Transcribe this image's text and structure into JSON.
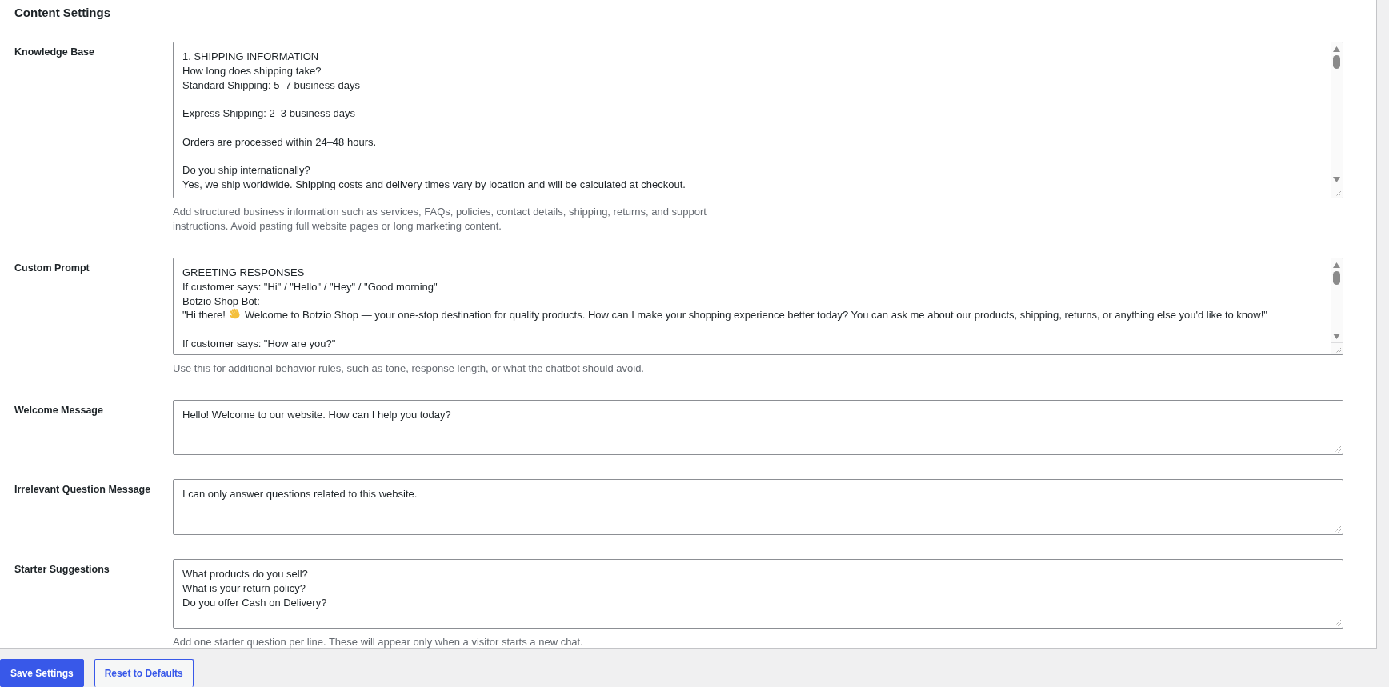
{
  "section": {
    "title": "Content Settings"
  },
  "fields": [
    {
      "label": "Knowledge Base",
      "value": [
        {
          "kind": "text",
          "text": "1. SHIPPING INFORMATION\nHow long does shipping take?\nStandard Shipping: 5–7 business days\n\nExpress Shipping: 2–3 business days\n\nOrders are processed within 24–48 hours.\n\nDo you ship internationally?\nYes, we ship worldwide. Shipping costs and delivery times vary by location and will be calculated at checkout."
        }
      ],
      "scrollbar": true,
      "help": "Add structured business information such as services, FAQs, policies, contact details, shipping, returns, and support instructions. Avoid pasting full website pages or long marketing content."
    },
    {
      "label": "Custom Prompt",
      "value": [
        {
          "kind": "text",
          "text": "GREETING RESPONSES\nIf customer says: \"Hi\" / \"Hello\" / \"Hey\" / \"Good morning\"\nBotzio Shop Bot:\n\"Hi there! "
        },
        {
          "kind": "icon"
        },
        {
          "kind": "text",
          "text": " Welcome to Botzio Shop — your one-stop destination for quality products. How can I make your shopping experience better today? You can ask me about our products, shipping, returns, or anything else you'd like to know!\"\n\nIf customer says: \"How are you?\""
        }
      ],
      "scrollbar": true,
      "help": "Use this for additional behavior rules, such as tone, response length, or what the chatbot should avoid."
    },
    {
      "label": "Welcome Message",
      "value": [
        {
          "kind": "text",
          "text": "Hello! Welcome to our website. How can I help you today?"
        }
      ],
      "scrollbar": false
    },
    {
      "label": "Irrelevant Question Message",
      "value": [
        {
          "kind": "text",
          "text": "I can only answer questions related to this website."
        }
      ],
      "scrollbar": false
    },
    {
      "label": "Starter Suggestions",
      "value": [
        {
          "kind": "text",
          "text": "What products do you sell?\nWhat is your return policy?\nDo you offer Cash on Delivery?"
        }
      ],
      "scrollbar": false,
      "help": "Add one starter question per line. These will appear only when a visitor starts a new chat."
    }
  ],
  "buttons": [
    {
      "label": "Save Settings",
      "kind": "primary"
    },
    {
      "label": "Reset to Defaults",
      "kind": "secondary"
    }
  ]
}
